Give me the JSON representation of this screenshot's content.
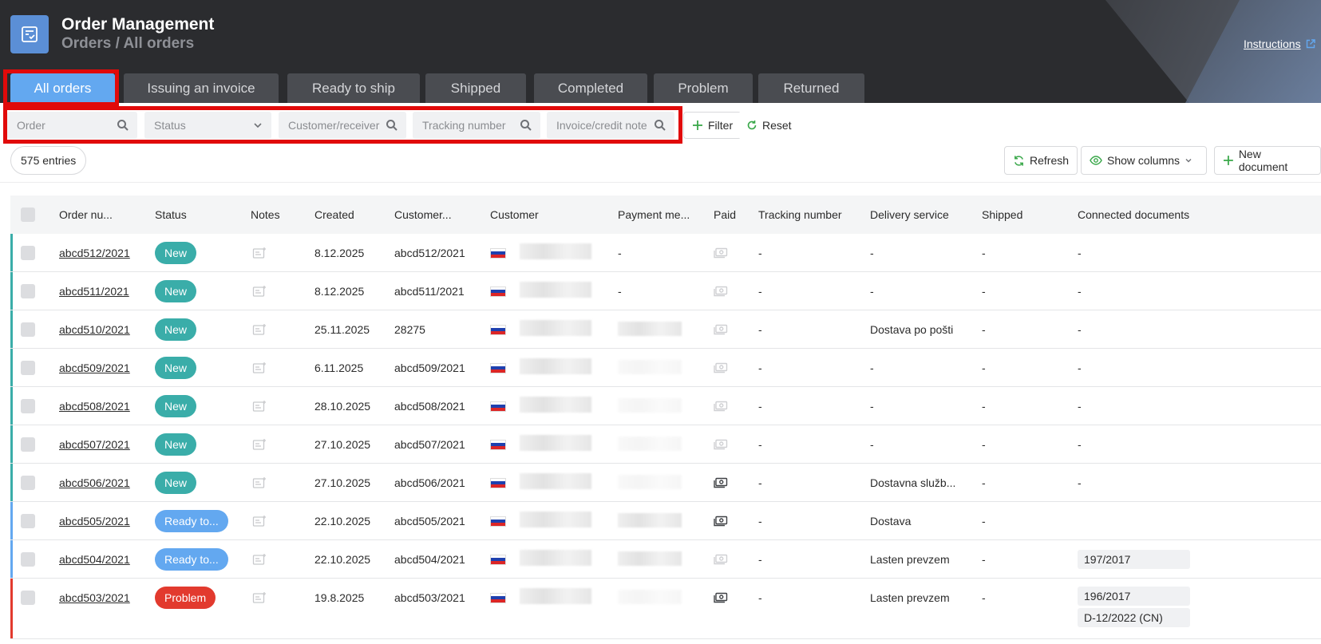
{
  "header": {
    "app_title": "Order Management",
    "breadcrumb": "Orders / All orders",
    "instructions": "Instructions"
  },
  "tabs": [
    {
      "label": "All orders",
      "active": true
    },
    {
      "label": "Issuing an invoice"
    },
    {
      "label": "Ready to ship"
    },
    {
      "label": "Shipped"
    },
    {
      "label": "Completed"
    },
    {
      "label": "Problem"
    },
    {
      "label": "Returned"
    }
  ],
  "filters": {
    "order_placeholder": "Order",
    "status_placeholder": "Status",
    "customer_placeholder": "Customer/receiver",
    "tracking_placeholder": "Tracking number",
    "invoice_placeholder": "Invoice/credit note",
    "filter_label": "Filter",
    "reset_label": "Reset"
  },
  "toolbar": {
    "entries": "575 entries",
    "refresh": "Refresh",
    "show_columns": "Show columns",
    "new_document": "New document"
  },
  "columns": [
    "Order nu...",
    "Status",
    "Notes",
    "Created",
    "Customer...",
    "Customer",
    "Payment me...",
    "Paid",
    "Tracking number",
    "Delivery service",
    "Shipped",
    "Connected documents"
  ],
  "colors": {
    "accent": "#63a8f0",
    "new": "#3aada9",
    "ready": "#63a8f0",
    "problem": "#e23a2e",
    "highlight": "#e10a0a"
  },
  "rows": [
    {
      "order": "abcd512/2021",
      "status": "New",
      "status_type": "new",
      "created": "8.12.2025",
      "customer_no": "abcd512/2021",
      "payment": "-",
      "paid": false,
      "tracking": "-",
      "delivery": "-",
      "shipped": "-",
      "docs": [
        "-"
      ],
      "bar": "new"
    },
    {
      "order": "abcd511/2021",
      "status": "New",
      "status_type": "new",
      "created": "8.12.2025",
      "customer_no": "abcd511/2021",
      "payment": "-",
      "paid": false,
      "tracking": "-",
      "delivery": "-",
      "shipped": "-",
      "docs": [
        "-"
      ],
      "bar": "new"
    },
    {
      "order": "abcd510/2021",
      "status": "New",
      "status_type": "new",
      "created": "25.11.2025",
      "customer_no": "28275",
      "payment": "",
      "paid": false,
      "tracking": "-",
      "delivery": "Dostava po pošti",
      "shipped": "-",
      "docs": [
        "-"
      ],
      "bar": "new"
    },
    {
      "order": "abcd509/2021",
      "status": "New",
      "status_type": "new",
      "created": "6.11.2025",
      "customer_no": "abcd509/2021",
      "payment": "",
      "paid": false,
      "tracking": "-",
      "delivery": "-",
      "shipped": "-",
      "docs": [
        "-"
      ],
      "bar": "new"
    },
    {
      "order": "abcd508/2021",
      "status": "New",
      "status_type": "new",
      "created": "28.10.2025",
      "customer_no": "abcd508/2021",
      "payment": "",
      "paid": false,
      "tracking": "-",
      "delivery": "-",
      "shipped": "-",
      "docs": [
        "-"
      ],
      "bar": "new"
    },
    {
      "order": "abcd507/2021",
      "status": "New",
      "status_type": "new",
      "created": "27.10.2025",
      "customer_no": "abcd507/2021",
      "payment": "",
      "paid": false,
      "tracking": "-",
      "delivery": "-",
      "shipped": "-",
      "docs": [
        "-"
      ],
      "bar": "new"
    },
    {
      "order": "abcd506/2021",
      "status": "New",
      "status_type": "new",
      "created": "27.10.2025",
      "customer_no": "abcd506/2021",
      "payment": "",
      "paid": true,
      "tracking": "-",
      "delivery": "Dostavna služb...",
      "shipped": "-",
      "docs": [
        "-"
      ],
      "bar": "new"
    },
    {
      "order": "abcd505/2021",
      "status": "Ready to...",
      "status_type": "ready",
      "created": "22.10.2025",
      "customer_no": "abcd505/2021",
      "payment": "",
      "paid": true,
      "tracking": "-",
      "delivery": "Dostava",
      "shipped": "-",
      "docs": [],
      "bar": "ready"
    },
    {
      "order": "abcd504/2021",
      "status": "Ready to...",
      "status_type": "ready",
      "created": "22.10.2025",
      "customer_no": "abcd504/2021",
      "payment": "",
      "paid": false,
      "tracking": "-",
      "delivery": "Lasten prevzem",
      "shipped": "-",
      "docs": [
        "197/2017"
      ],
      "bar": "ready"
    },
    {
      "order": "abcd503/2021",
      "status": "Problem",
      "status_type": "problem",
      "created": "19.8.2025",
      "customer_no": "abcd503/2021",
      "payment": "",
      "paid": true,
      "tracking": "-",
      "delivery": "Lasten prevzem",
      "shipped": "-",
      "docs": [
        "196/2017",
        "D-12/2022 (CN)"
      ],
      "bar": "problem"
    }
  ]
}
